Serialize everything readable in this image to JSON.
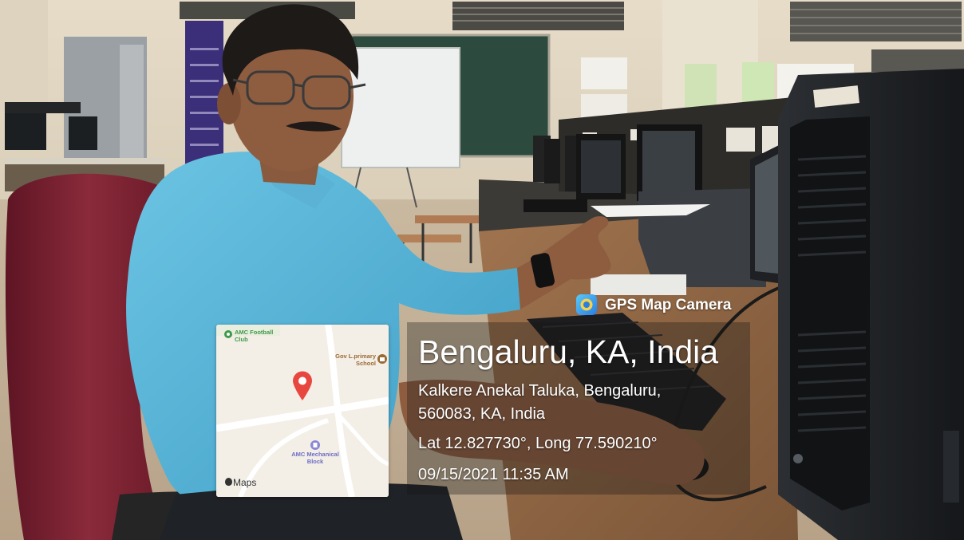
{
  "app_badge": {
    "name": "GPS Map Camera",
    "icon": "gps-map-camera-icon"
  },
  "location": {
    "title": "Bengaluru, KA, India",
    "address_line1": "Kalkere Anekal Taluka, Bengaluru,",
    "address_line2": "560083, KA, India",
    "coordinates": "Lat 12.827730°, Long 77.590210°",
    "datetime": "09/15/2021 11:35 AM"
  },
  "map": {
    "pois": {
      "football_club": "AMC Football Club",
      "school": "Gov L.primary School",
      "mechanical_block": "AMC Mechanical Block"
    },
    "attribution": "Maps",
    "pin_icon": "location-pin-icon"
  },
  "colors": {
    "shirt": "#5fb8d9",
    "chair": "#7d2233",
    "pin": "#e8473f",
    "map_bg": "#f3efe6",
    "poi_green": "#3d9a4a",
    "poi_brown": "#9a6a35",
    "poi_purple": "#6e6cc7"
  }
}
